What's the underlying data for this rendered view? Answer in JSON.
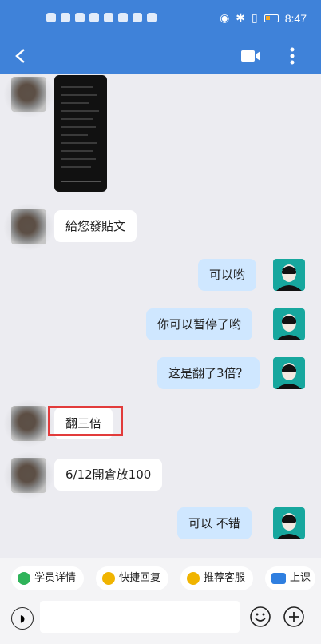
{
  "status": {
    "time": "8:47"
  },
  "header": {
    "back_icon": "back-arrow-icon",
    "video_icon": "video-call-icon",
    "more_icon": "more-vertical-icon"
  },
  "messages": [
    {
      "side": "in",
      "type": "image",
      "content": "screenshot"
    },
    {
      "side": "in",
      "type": "text",
      "text": "給您發貼文"
    },
    {
      "side": "out",
      "type": "text",
      "text": "可以哟"
    },
    {
      "side": "out",
      "type": "text",
      "text": "你可以暂停了哟"
    },
    {
      "side": "out",
      "type": "text",
      "text": "这是翻了3倍？"
    },
    {
      "side": "in",
      "type": "text",
      "text": "翻三倍",
      "highlighted": true
    },
    {
      "side": "in",
      "type": "text",
      "text": "6/12開倉放100"
    },
    {
      "side": "out",
      "type": "text",
      "text": "可以  不错"
    }
  ],
  "quick_actions": [
    {
      "label": "学员详情",
      "icon": "user-icon",
      "color": "#2fb35a"
    },
    {
      "label": "快捷回复",
      "icon": "message-icon",
      "color": "#f0b400"
    },
    {
      "label": "推荐客服",
      "icon": "chat-icon",
      "color": "#f0b400"
    },
    {
      "label": "上课",
      "icon": "live-icon",
      "color": "#2f7fe0"
    }
  ],
  "input": {
    "placeholder": "",
    "voice_icon": "voice-icon",
    "emoji_icon": "emoji-icon",
    "plus_icon": "plus-icon"
  },
  "colors": {
    "primary": "#3f82d9",
    "chat_bg": "#ececf1",
    "out_bubble": "#cfe7ff",
    "highlight": "#e23b3b"
  }
}
